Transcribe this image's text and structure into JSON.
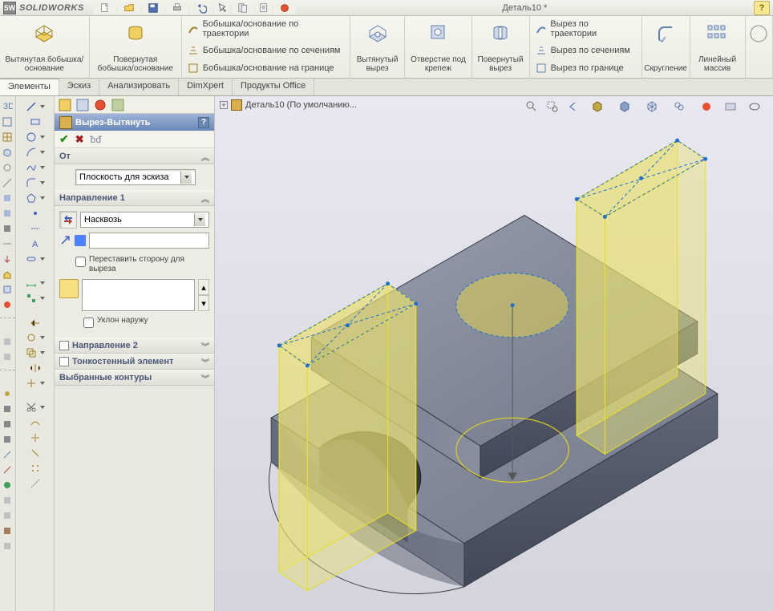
{
  "app": {
    "name": "SOLIDWORKS",
    "doc_title": "Деталь10 *"
  },
  "ribbon": {
    "extrude_boss": "Вытянутая бобышка/основание",
    "revolve_boss": "Повернутая бобышка/основание",
    "sweep_boss": "Бобышка/основание по траектории",
    "loft_boss": "Бобышка/основание по сечениям",
    "boundary_boss": "Бобышка/основание на границе",
    "extrude_cut": "Вытянутый вырез",
    "hole": "Отверстие под крепеж",
    "revolve_cut": "Повернутый вырез",
    "sweep_cut": "Вырез по траектории",
    "loft_cut": "Вырез по сечениям",
    "boundary_cut": "Вырез по границе",
    "fillet": "Скругление",
    "linpattern": "Линейный массив"
  },
  "tabs": [
    "Элементы",
    "Эскиз",
    "Анализировать",
    "DimXpert",
    "Продукты Office"
  ],
  "propmgr": {
    "title": "Вырез-Вытянуть",
    "from": {
      "head": "От",
      "sel": "Плоскость для эскиза"
    },
    "dir1": {
      "head": "Направление 1",
      "type": "Насквозь",
      "flip_side": "Переставить сторону для выреза",
      "draft_out": "Уклон наружу"
    },
    "dir2": "Направление 2",
    "thin": "Тонкостенный элемент",
    "contours": "Выбранные контуры"
  },
  "tree": {
    "root": "Деталь10  (По умолчанию..."
  }
}
